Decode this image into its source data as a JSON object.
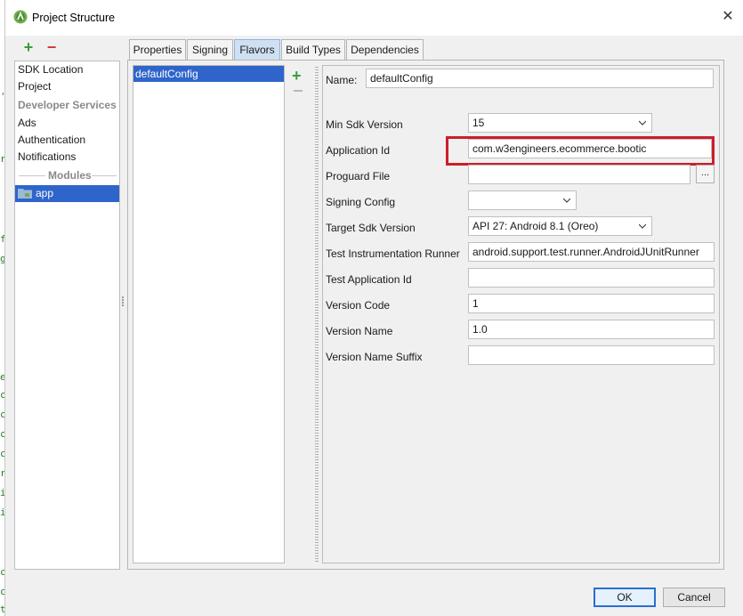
{
  "window": {
    "title": "Project Structure",
    "close_glyph": "✕"
  },
  "left_toolbar": {
    "add_glyph": "+",
    "remove_glyph": "−"
  },
  "sidebar": {
    "items": [
      {
        "label": "SDK Location",
        "type": "item"
      },
      {
        "label": "Project",
        "type": "item"
      },
      {
        "label": "Developer Services",
        "type": "section"
      },
      {
        "label": "Ads",
        "type": "item"
      },
      {
        "label": "Authentication",
        "type": "item"
      },
      {
        "label": "Notifications",
        "type": "item"
      },
      {
        "label": "Modules",
        "type": "section"
      },
      {
        "label": "app",
        "type": "item",
        "selected": true,
        "icon": "module-folder-icon"
      }
    ]
  },
  "tabs": [
    {
      "label": "Properties",
      "active": false
    },
    {
      "label": "Signing",
      "active": false
    },
    {
      "label": "Flavors",
      "active": true
    },
    {
      "label": "Build Types",
      "active": false
    },
    {
      "label": "Dependencies",
      "active": false
    }
  ],
  "flavors": {
    "items": [
      {
        "label": "defaultConfig",
        "selected": true
      }
    ],
    "add_glyph": "+"
  },
  "form": {
    "name_label": "Name:",
    "name_value": "defaultConfig",
    "fields": {
      "min_sdk": {
        "label": "Min Sdk Version",
        "value": "15"
      },
      "application_id": {
        "label": "Application Id",
        "value": "com.w3engineers.ecommerce.bootic",
        "highlighted": true
      },
      "proguard_file": {
        "label": "Proguard File",
        "value": "",
        "browse_label": "..."
      },
      "signing_config": {
        "label": "Signing Config",
        "value": ""
      },
      "target_sdk": {
        "label": "Target Sdk Version",
        "value": "API 27: Android 8.1 (Oreo)"
      },
      "test_runner": {
        "label": "Test Instrumentation Runner",
        "value": "android.support.test.runner.AndroidJUnitRunner"
      },
      "test_app_id": {
        "label": "Test Application Id",
        "value": ""
      },
      "version_code": {
        "label": "Version Code",
        "value": "1"
      },
      "version_name": {
        "label": "Version Name",
        "value": "1.0"
      },
      "version_name_suffix": {
        "label": "Version Name Suffix",
        "value": ""
      }
    }
  },
  "buttons": {
    "ok": "OK",
    "cancel": "Cancel"
  },
  "colors": {
    "selection": "#2f65ca",
    "active_tab": "#cfe0f3",
    "highlight_box": "#cc1e2a",
    "add_green": "#3c9b3c",
    "remove_red": "#d03b3b"
  }
}
